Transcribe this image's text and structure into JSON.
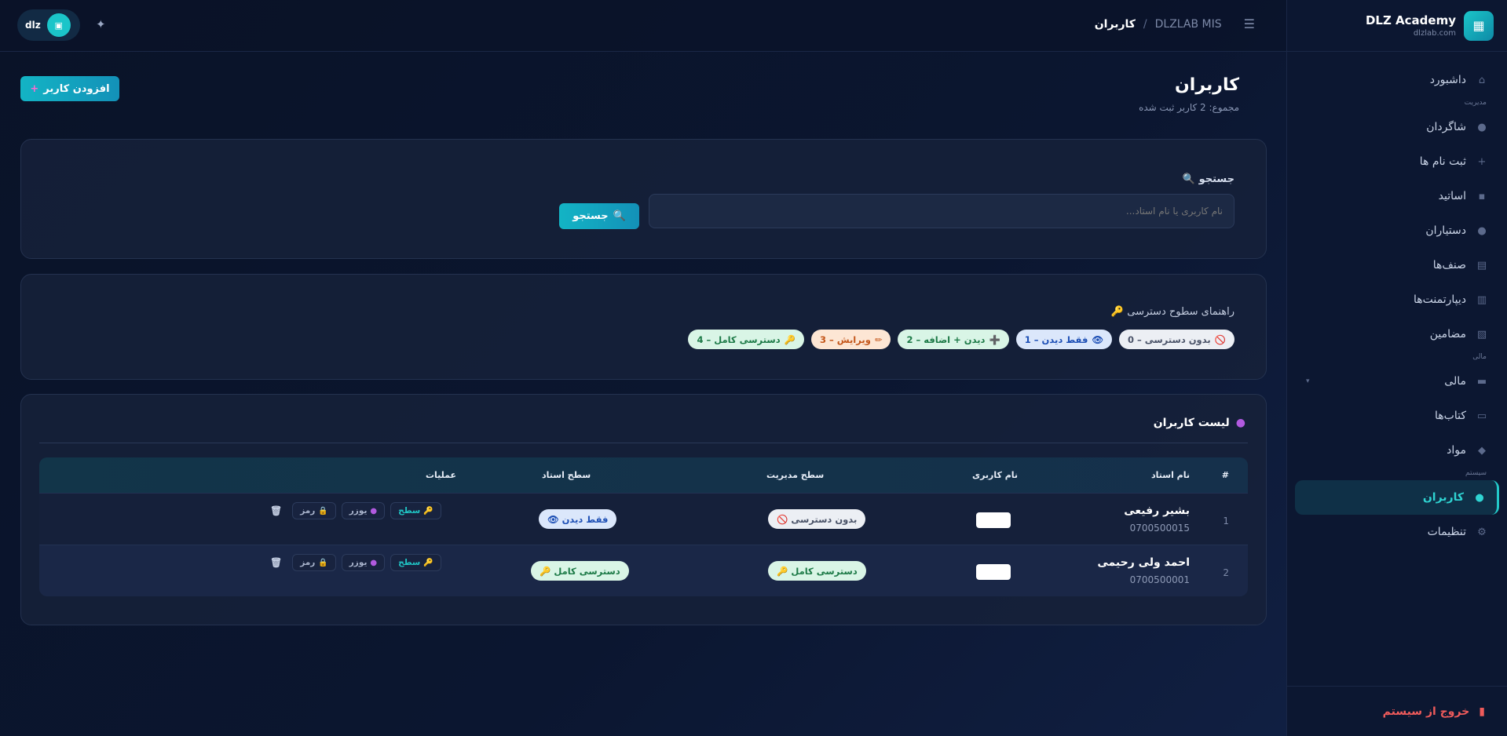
{
  "brand": {
    "name": "DLZ Academy",
    "domain": "dlzlab.com",
    "logo_icon": "▦"
  },
  "topbar": {
    "breadcrumb_current": "کاربران",
    "breadcrumb_sep": "/",
    "breadcrumb_root": "DLZLAB MIS",
    "menu_icon": "☰",
    "user_short": "dlz",
    "avatar_icon": "▣",
    "theme_icon": "✦"
  },
  "sidebar": {
    "dashboard": {
      "label": "داشبورد",
      "icon": "⌂"
    },
    "section_management": "مدیریت",
    "students": {
      "label": "شاگردان",
      "icon": "●"
    },
    "enrollments": {
      "label": "ثبت نام ها",
      "icon": "+"
    },
    "teachers": {
      "label": "اساتید",
      "icon": "▪"
    },
    "assistants": {
      "label": "دستیاران",
      "icon": "●"
    },
    "classes": {
      "label": "صنف‌ها",
      "icon": "▤"
    },
    "departments": {
      "label": "دیپارتمنت‌ها",
      "icon": "▥"
    },
    "subjects": {
      "label": "مضامین",
      "icon": "▧"
    },
    "section_finance": "مالی",
    "finance": {
      "label": "مالی",
      "icon": "▬",
      "caret": "▾"
    },
    "books": {
      "label": "کتاب‌ها",
      "icon": "▭"
    },
    "materials": {
      "label": "مواد",
      "icon": "◆"
    },
    "section_system": "سیستم",
    "users": {
      "label": "کاربران",
      "icon": "●"
    },
    "settings": {
      "label": "تنظیمات",
      "icon": "⚙"
    },
    "logout": {
      "label": "خروج از سیستم",
      "icon": "▮"
    }
  },
  "page": {
    "title": "کاربران",
    "subtitle": "مجموع: 2 کاربر ثبت شده",
    "add_button": "افزودن کاربر",
    "add_icon": "+"
  },
  "search": {
    "label": "🔍 جستجو",
    "placeholder": "نام کاربری یا نام استاد...",
    "button": "جستجو",
    "button_icon": "🔍"
  },
  "legend": {
    "title": "🔑 راهنمای سطوح دسترسی",
    "items": [
      {
        "icon": "🚫",
        "text": "0 – بدون دسترسی"
      },
      {
        "icon": "👁",
        "text": "1 – فقط دیدن"
      },
      {
        "icon": "➕",
        "text": "2 – دیدن + اضافه"
      },
      {
        "icon": "✏",
        "text": "3 – ویرایش"
      },
      {
        "icon": "🔑",
        "text": "4 – دسترسی کامل"
      }
    ]
  },
  "users_list": {
    "title": "لیست کاربران",
    "title_icon": "●",
    "headers": {
      "num": "#",
      "teacher": "نام استاد",
      "username": "نام کاربری",
      "mgmt": "سطح مدیریت",
      "teach": "سطح استاد",
      "ops": "عملیات"
    },
    "ops_labels": {
      "level": "سطح",
      "user": "یوزر",
      "pass": "رمز",
      "delete_icon": "🗑",
      "level_icon": "🔑",
      "user_icon": "●",
      "pass_icon": "🔒"
    },
    "rows": [
      {
        "num": "1",
        "name": "بشیر رفیعی",
        "phone": "0700500015",
        "mgmt": "🚫 بدون دسترسی",
        "teach": "👁 فقط دیدن"
      },
      {
        "num": "2",
        "name": "احمد ولی رحیمی",
        "phone": "0700500001",
        "mgmt": "🔑 دسترسی کامل",
        "teach": "🔑 دسترسی کامل"
      }
    ]
  }
}
